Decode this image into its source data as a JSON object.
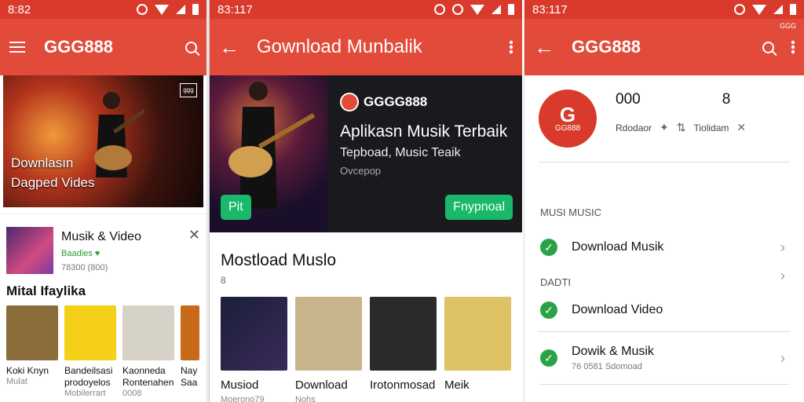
{
  "p1": {
    "time": "8:82",
    "title": "GGG888",
    "hero_line1": "Downlasın",
    "hero_line2": "Dagped Vides",
    "hero_badge": "ggg",
    "song_title": "Musik & Video",
    "song_genre": "Baadies ♥",
    "song_stats": "78300 (800)",
    "section": "Mital Ifaylika",
    "cards": [
      {
        "t": "Koki Knyn",
        "s": "Mulat",
        "color": "#8a6d3b"
      },
      {
        "t": "Bandeilsasi prodoyelos",
        "s": "Mobilerrart",
        "color": "#f4d018"
      },
      {
        "t": "Kaonneda Rontenahen",
        "s": "0008",
        "color": "#d7d2c7"
      },
      {
        "t": "Nay Saa",
        "s": "",
        "color": "#c96a1a"
      }
    ]
  },
  "p2": {
    "time": "83:117",
    "title": "Gownload Munbalik",
    "brand": "GGGG888",
    "headline": "Aplikasn Musik Terbaik",
    "sub": "Tepboad, Music Teaik",
    "meta": "Ovcepop",
    "btn_left": "Pit",
    "btn_right": "Fnypnoal",
    "section": "Mostload Muslo",
    "section_sub": "8",
    "cards": [
      {
        "t": "Musiod",
        "s": "Moerono79",
        "color": "#23243a"
      },
      {
        "t": "Download",
        "s": "Nohs",
        "color": "#c7b48a"
      },
      {
        "t": "Irotonmosad",
        "s": "",
        "color": "#2a2a2a"
      },
      {
        "t": "Meik",
        "s": "",
        "color": "#e0c266"
      }
    ]
  },
  "p3": {
    "time": "83:117",
    "tiny": "GGG",
    "title": "GGG888",
    "avatar_glyph": "G",
    "avatar_name": "GG888",
    "stat1": "000",
    "stat2": "8",
    "label1": "Rdodaor",
    "label2": "Tiolidam",
    "section1": "MUSI MUSIC",
    "item1": "Download Musik",
    "section2": "DADTI",
    "item2": "Download Video",
    "item3": "Dowik & Musik",
    "item3_sub": "76 0581 Sdomoad"
  }
}
